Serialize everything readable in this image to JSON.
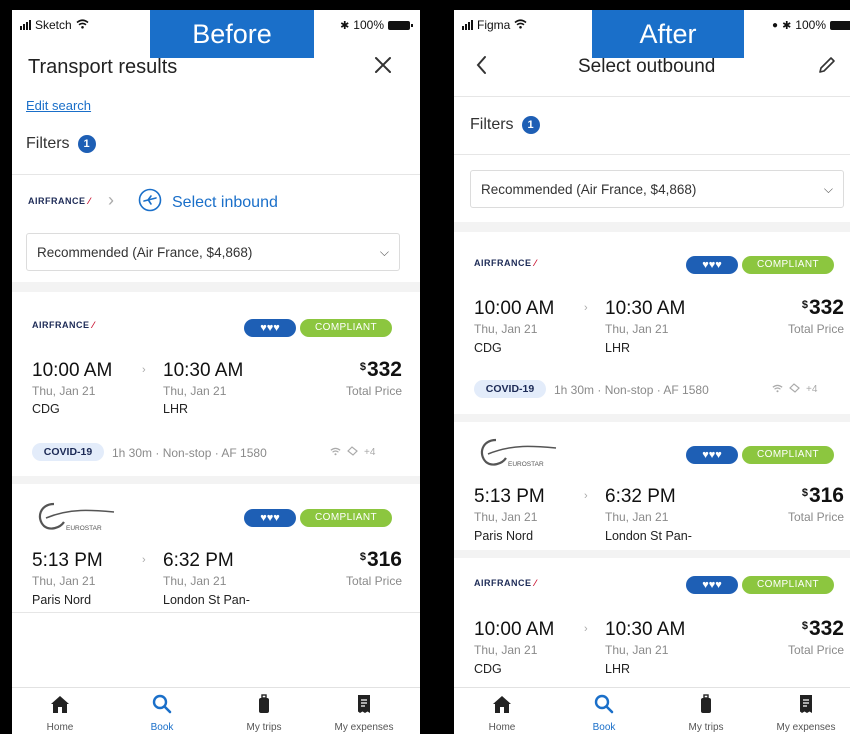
{
  "before": {
    "label": "Before",
    "status": {
      "carrier": "Sketch",
      "battery": "100%"
    },
    "header": {
      "title": "Transport results"
    },
    "edit_search": "Edit search",
    "filters": {
      "label": "Filters",
      "count": "1"
    },
    "journey": {
      "select_inbound": "Select inbound"
    },
    "sort": {
      "selected": "Recommended (Air France, $4,868)"
    },
    "results": [
      {
        "carrier_logo": "AIRFRANCE",
        "compliance": "COMPLIANT",
        "depart_time": "10:00 AM",
        "depart_date": "Thu, Jan 21",
        "depart_station": "CDG",
        "arrive_time": "10:30 AM",
        "arrive_date": "Thu, Jan 21",
        "arrive_station": "LHR",
        "currency": "$",
        "price": "332",
        "price_label": "Total Price",
        "covid": "COVID-19",
        "details": "1h 30m · Non-stop · AF 1580",
        "amenity_more": "+4"
      },
      {
        "carrier_logo": "EUROSTAR",
        "compliance": "COMPLIANT",
        "depart_time": "5:13 PM",
        "depart_date": "Thu, Jan 21",
        "depart_station": "Paris Nord",
        "arrive_time": "6:32 PM",
        "arrive_date": "Thu, Jan 21",
        "arrive_station": "London St Pan-",
        "currency": "$",
        "price": "316",
        "price_label": "Total Price"
      }
    ],
    "tabs": [
      {
        "label": "Home",
        "icon": "home-icon"
      },
      {
        "label": "Book",
        "icon": "search-icon",
        "active": true
      },
      {
        "label": "My trips",
        "icon": "luggage-icon"
      },
      {
        "label": "My expenses",
        "icon": "receipt-icon"
      }
    ]
  },
  "after": {
    "label": "After",
    "status": {
      "carrier": "Figma",
      "battery": "100%"
    },
    "header": {
      "title": "Select outbound"
    },
    "filters": {
      "label": "Filters",
      "count": "1"
    },
    "sort": {
      "selected": "Recommended (Air France, $4,868)"
    },
    "results": [
      {
        "carrier_logo": "AIRFRANCE",
        "compliance": "COMPLIANT",
        "depart_time": "10:00 AM",
        "depart_date": "Thu, Jan 21",
        "depart_station": "CDG",
        "arrive_time": "10:30 AM",
        "arrive_date": "Thu, Jan 21",
        "arrive_station": "LHR",
        "currency": "$",
        "price": "332",
        "price_label": "Total Price",
        "covid": "COVID-19",
        "details": "1h 30m · Non-stop · AF 1580",
        "amenity_more": "+4"
      },
      {
        "carrier_logo": "EUROSTAR",
        "compliance": "COMPLIANT",
        "depart_time": "5:13 PM",
        "depart_date": "Thu, Jan 21",
        "depart_station": "Paris Nord",
        "arrive_time": "6:32 PM",
        "arrive_date": "Thu, Jan 21",
        "arrive_station": "London St Pan-",
        "currency": "$",
        "price": "316",
        "price_label": "Total Price"
      },
      {
        "carrier_logo": "AIRFRANCE",
        "compliance": "COMPLIANT",
        "depart_time": "10:00 AM",
        "depart_date": "Thu, Jan 21",
        "depart_station": "CDG",
        "arrive_time": "10:30 AM",
        "arrive_date": "Thu, Jan 21",
        "arrive_station": "LHR",
        "currency": "$",
        "price": "332",
        "price_label": "Total Price"
      }
    ],
    "tabs": [
      {
        "label": "Home",
        "icon": "home-icon"
      },
      {
        "label": "Book",
        "icon": "search-icon",
        "active": true
      },
      {
        "label": "My trips",
        "icon": "luggage-icon"
      },
      {
        "label": "My expenses",
        "icon": "receipt-icon"
      }
    ]
  },
  "colors": {
    "brand_blue": "#1a6fc9",
    "compliant_green": "#8cc63f",
    "badge_blue": "#1e5fb5"
  }
}
